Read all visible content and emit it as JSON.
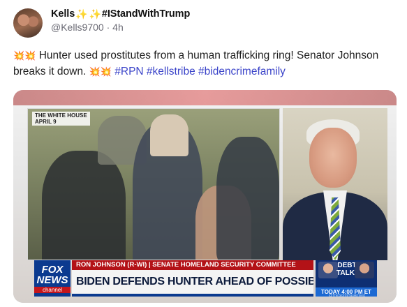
{
  "post": {
    "display_name": "Kells",
    "display_name_suffix": "#IStandWithTrump",
    "handle": "@Kells9700",
    "separator": "·",
    "time": "4h",
    "text_main": "Hunter used prostitutes from a human trafficking ring! Senator Johnson breaks it down.",
    "hashtags": [
      "#RPN",
      "#kellstribe",
      "#bidencrimefamily"
    ],
    "icons": [
      "sparkles-icon",
      "collision-icon"
    ]
  },
  "video": {
    "location_label": "THE WHITE HOUSE",
    "date_label": "APRIL 9",
    "network_line1": "FOX",
    "network_line2": "NEWS",
    "network_line3": "channel",
    "strap_top": "RON JOHNSON (R-WI) | SENATE HOMELAND SECURITY COMMITTEE",
    "strap_main": "BIDEN DEFENDS HUNTER AHEAD OF POSSIBLE CHARGES",
    "promo_title": "DEBT TALKS",
    "promo_time": "TODAY 4:00 PM ET",
    "watermark": "@TheStormHasArrived"
  },
  "colors": {
    "hashtag": "#3b44c9",
    "fox_red": "#b31217",
    "fox_blue": "#0b3a8f"
  }
}
